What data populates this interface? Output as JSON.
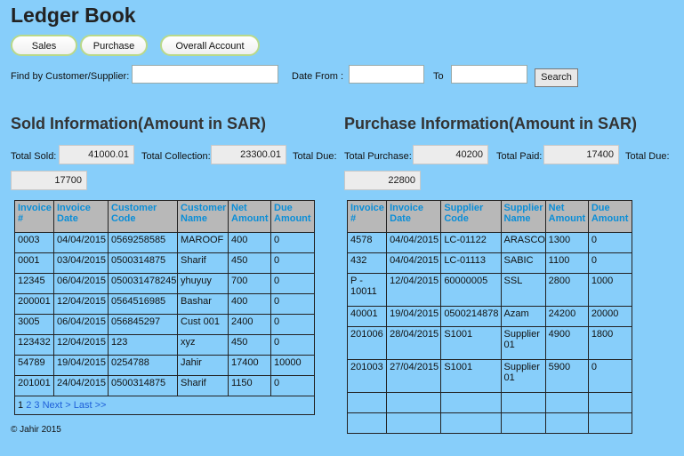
{
  "title": "Ledger Book",
  "nav": {
    "sales": "Sales",
    "purchase": "Purchase",
    "overall": "Overall Account"
  },
  "filter": {
    "find_label": "Find by Customer/Supplier:",
    "date_from_label": "Date From :",
    "to_label": "To",
    "search_button": "Search"
  },
  "sold": {
    "heading": "Sold Information(Amount in SAR)",
    "total_sold_label": "Total Sold:",
    "total_sold": "41000.01",
    "total_collection_label": "Total Collection:",
    "total_collection": "23300.01",
    "total_due_label": "Total Due:",
    "total_due": "17700",
    "columns": [
      "Invoice #",
      "Invoice Date",
      "Customer Code",
      "Customer Name",
      "Net Amount",
      "Due Amount"
    ],
    "rows": [
      [
        "0003",
        "04/04/2015",
        "0569258585",
        "MAROOF",
        "400",
        "0"
      ],
      [
        "0001",
        "03/04/2015",
        "0500314875",
        "Sharif",
        "450",
        "0"
      ],
      [
        "12345",
        "06/04/2015",
        "050031478245",
        "yhuyuy",
        "700",
        "0"
      ],
      [
        "200001",
        "12/04/2015",
        "0564516985",
        "Bashar",
        "400",
        "0"
      ],
      [
        "3005",
        "06/04/2015",
        "056845297",
        "Cust 001",
        "2400",
        "0"
      ],
      [
        "123432",
        "12/04/2015",
        "123",
        "xyz",
        "450",
        "0"
      ],
      [
        "54789",
        "19/04/2015",
        "0254788",
        "Jahir",
        "17400",
        "10000"
      ],
      [
        "201001",
        "24/04/2015",
        "0500314875",
        "Sharif",
        "1150",
        "0"
      ]
    ],
    "pager": {
      "current": "1",
      "p2": "2",
      "p3": "3",
      "next": "Next >",
      "last": "Last >>"
    }
  },
  "purchase": {
    "heading": "Purchase Information(Amount in SAR)",
    "total_purchase_label": "Total Purchase:",
    "total_purchase": "40200",
    "total_paid_label": "Total Paid:",
    "total_paid": "17400",
    "total_due_label": "Total Due:",
    "total_due": "22800",
    "columns": [
      "Invoice #",
      "Invoice Date",
      "Supplier Code",
      "Supplier Name",
      "Net Amount",
      "Due Amount"
    ],
    "rows": [
      [
        "4578",
        "04/04/2015",
        "LC-01122",
        "ARASCO",
        "1300",
        "0"
      ],
      [
        "432",
        "04/04/2015",
        "LC-01113",
        "SABIC",
        "1100",
        "0"
      ],
      [
        "P - 10011",
        "12/04/2015",
        "60000005",
        "SSL",
        "2800",
        "1000"
      ],
      [
        "40001",
        "19/04/2015",
        "0500214878",
        "Azam",
        "24200",
        "20000"
      ],
      [
        "201006",
        "28/04/2015",
        "S1001",
        "Supplier 01",
        "4900",
        "1800"
      ],
      [
        "201003",
        "27/04/2015",
        "S1001",
        "Supplier 01",
        "5900",
        "0"
      ]
    ]
  },
  "footer": "© Jahir 2015"
}
